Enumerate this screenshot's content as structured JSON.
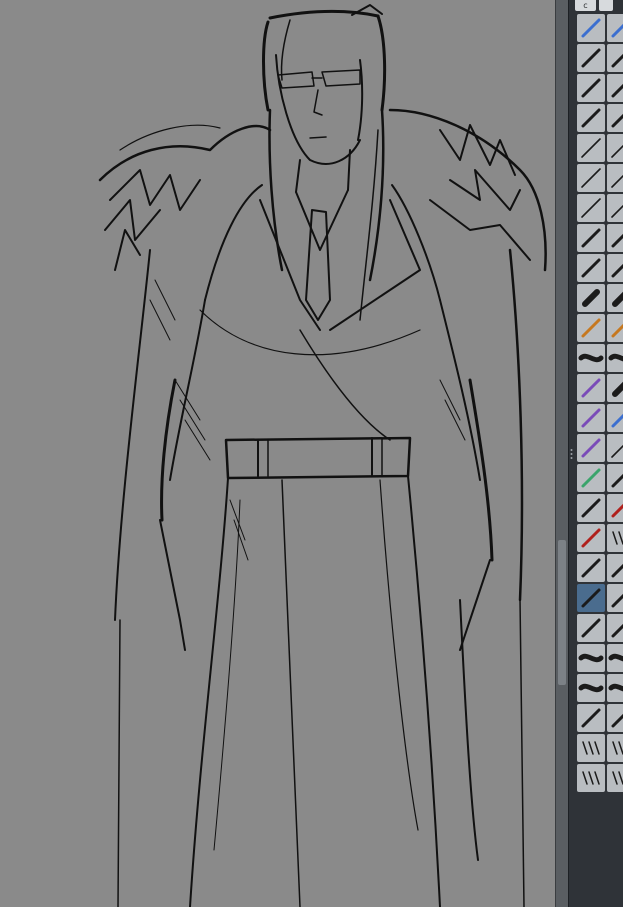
{
  "panel": {
    "tabs": [
      "c",
      ""
    ],
    "brushes": [
      {
        "a": "eraser-icon",
        "b": "eraser-icon"
      },
      {
        "a": "pen-nib-icon",
        "b": "pen-nib-icon"
      },
      {
        "a": "ink-pen-icon",
        "b": "brush-icon"
      },
      {
        "a": "brush-stroke-icon",
        "b": "brush-icon"
      },
      {
        "a": "fine-pen-icon",
        "b": "pencil-icon"
      },
      {
        "a": "pencil-icon",
        "b": "pencil-icon"
      },
      {
        "a": "line-pen-icon",
        "b": "line-pen-icon"
      },
      {
        "a": "marker-icon",
        "b": "marker-icon"
      },
      {
        "a": "marker-icon",
        "b": "brush-icon"
      },
      {
        "a": "round-brush-icon",
        "b": "round-brush-icon"
      },
      {
        "a": "orange-brush-icon",
        "b": "orange-brush-icon"
      },
      {
        "a": "airbrush-icon",
        "b": "airbrush-icon"
      },
      {
        "a": "purple-brush-icon",
        "b": "square-brush-icon"
      },
      {
        "a": "purple-brush-icon",
        "b": "blue-brush-icon"
      },
      {
        "a": "purple-ink-icon",
        "b": "line-pen-icon"
      },
      {
        "a": "green-ink-icon",
        "b": "ink-pen-icon"
      },
      {
        "a": "fountain-pen-icon",
        "b": "red-brush-icon"
      },
      {
        "a": "red-brush-icon",
        "b": "hatch-brush-icon"
      },
      {
        "a": "calligraphy-icon",
        "b": "calligraphy-icon"
      },
      {
        "a": "selected-brush-icon",
        "b": "blender-icon"
      },
      {
        "a": "ink-brush-icon",
        "b": "color-brush-icon"
      },
      {
        "a": "texture-brush-icon",
        "b": "texture-brush-icon"
      },
      {
        "a": "grain-brush-icon",
        "b": "grain-brush-icon"
      },
      {
        "a": "knife-brush-icon",
        "b": "knife-brush-icon"
      },
      {
        "a": "scatter-brush-icon",
        "b": "scatter-brush-icon"
      },
      {
        "a": "halftone-brush-icon",
        "b": "halftone-brush-icon"
      }
    ],
    "selected_index": 19
  },
  "colors": {
    "canvas": "#8a8a8a",
    "panel": "#2f3338",
    "cell": "#b9bdc1",
    "selected": "#4a6c8e",
    "ink": "#111111"
  }
}
